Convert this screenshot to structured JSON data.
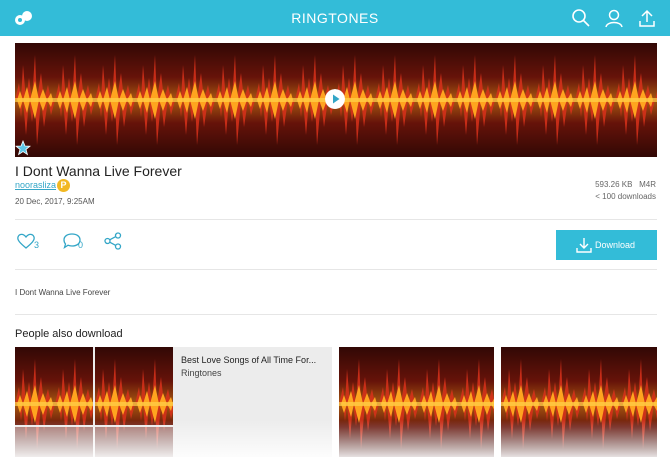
{
  "topbar": {
    "title": "RINGTONES",
    "logo_icon": "zedge-logo-icon",
    "icons": [
      "search-icon",
      "user-icon",
      "upload-icon"
    ],
    "bg_color": "#33bcd8"
  },
  "ringtone": {
    "title": "I Dont Wanna Live Forever",
    "author": "noorasliza",
    "author_badge": "P",
    "date": "20 Dec, 2017, 9:25AM",
    "size": "593.26 KB",
    "format": "M4R",
    "downloads": "< 100 downloads",
    "likes": "3",
    "comments": "0",
    "download_label": "Download",
    "description": "I Dont Wanna Live Forever"
  },
  "related": {
    "heading": "People also download",
    "cards": [
      {
        "title": "Best Love Songs of All Time For...",
        "subtitle": "Ringtones"
      },
      {
        "title": "",
        "subtitle": ""
      },
      {
        "title": "",
        "subtitle": ""
      }
    ]
  },
  "colors": {
    "accent": "#33bcd8",
    "link": "#33a6c7",
    "badge": "#f2b822",
    "wave_dark": "#3a0a06",
    "wave_bright": "#ff9a1a"
  }
}
